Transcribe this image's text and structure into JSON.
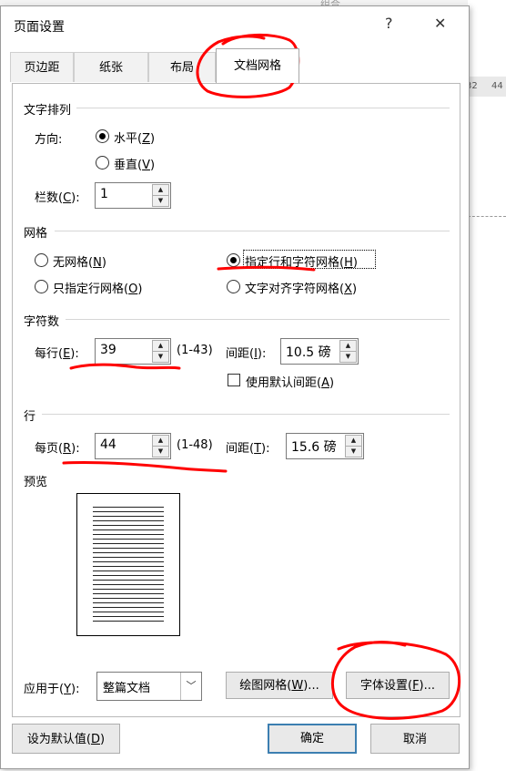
{
  "background": {
    "ruler_ticks": [
      "32",
      "44"
    ],
    "ribbon_hint": "组合"
  },
  "titlebar": {
    "title": "页面设置",
    "help": "?",
    "close": "✕"
  },
  "tabs": [
    "页边距",
    "纸张",
    "布局",
    "文档网格"
  ],
  "active_tab": "文档网格",
  "text_layout": {
    "title": "文字排列",
    "direction_label": "方向:",
    "horizontal": {
      "label": "水平(",
      "key": "Z",
      "end": ")",
      "checked": true
    },
    "vertical": {
      "label": "垂直(",
      "key": "V",
      "end": ")",
      "checked": false
    },
    "columns_label": {
      "pre": "栏数(",
      "key": "C",
      "post": "):"
    },
    "columns_value": "1"
  },
  "grid": {
    "title": "网格",
    "no_grid": {
      "label": "无网格(",
      "key": "N",
      "end": ")"
    },
    "lines_only": {
      "label": "只指定行网格(",
      "key": "O",
      "end": ")"
    },
    "lines_and_chars": {
      "label": "指定行和字符网格(",
      "key": "H",
      "end": ")",
      "checked": true
    },
    "snap_chars": {
      "label": "文字对齐字符网格(",
      "key": "X",
      "end": ")"
    }
  },
  "characters": {
    "title": "字符数",
    "per_line_label": {
      "pre": "每行(",
      "key": "E",
      "post": "):"
    },
    "per_line_value": "39",
    "per_line_range": "(1-43)",
    "pitch_label": {
      "pre": "间距(",
      "key": "I",
      "post": "):"
    },
    "pitch_value": "10.5 磅",
    "default_pitch": {
      "label": "使用默认间距(",
      "key": "A",
      "end": ")",
      "checked": false
    }
  },
  "lines": {
    "title": "行",
    "per_page_label": {
      "pre": "每页(",
      "key": "R",
      "post": "):"
    },
    "per_page_value": "44",
    "per_page_range": "(1-48)",
    "pitch_label": {
      "pre": "间距(",
      "key": "T",
      "post": "):"
    },
    "pitch_value": "15.6 磅"
  },
  "preview": {
    "title": "预览"
  },
  "apply_to": {
    "pre": "应用于(",
    "key": "Y",
    "post": "):",
    "value": "整篇文档"
  },
  "buttons": {
    "drawing_grid": {
      "pre": "绘图网格(",
      "key": "W",
      "post": ")..."
    },
    "font_settings": {
      "pre": "字体设置(",
      "key": "F",
      "post": ")..."
    },
    "set_default": {
      "pre": "设为默认值(",
      "key": "D",
      "post": ")"
    },
    "ok": "确定",
    "cancel": "取消"
  },
  "colors": {
    "annotation": "#ff0000",
    "default_button_border": "#3c7fb1"
  }
}
